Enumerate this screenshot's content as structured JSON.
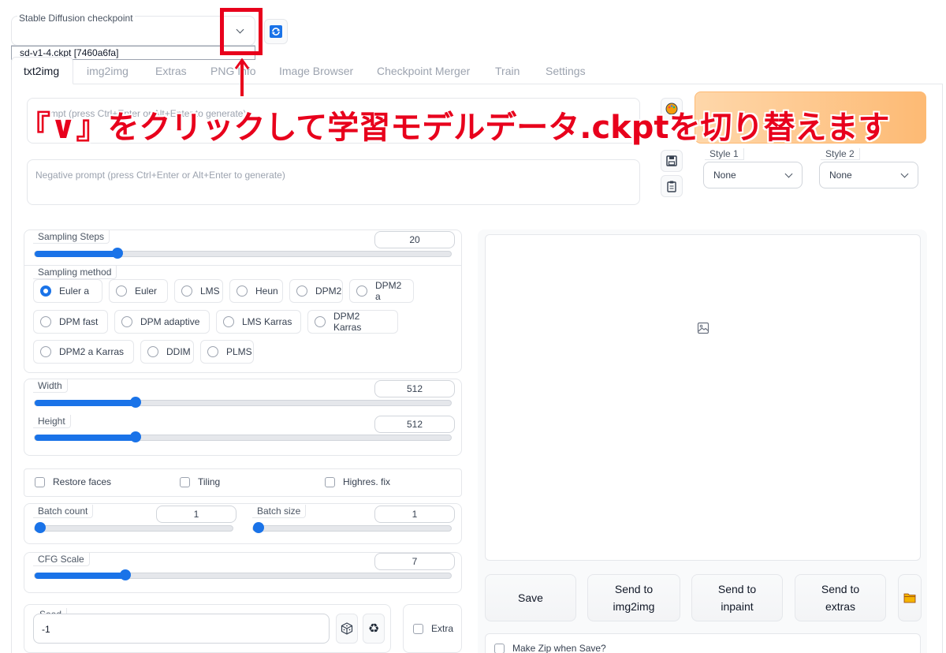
{
  "checkpoint": {
    "label": "Stable Diffusion checkpoint",
    "dropdown_option": "sd-v1-4.ckpt [7460a6fa]",
    "refresh_icon": "refresh-icon"
  },
  "tabs": [
    "txt2img",
    "img2img",
    "Extras",
    "PNG Info",
    "Image Browser",
    "Checkpoint Merger",
    "Train",
    "Settings"
  ],
  "prompt": {
    "placeholder": "Prompt (press Ctrl+Enter or Alt+Enter to generate)",
    "negative_placeholder": "Negative prompt (press Ctrl+Enter or Alt+Enter to generate)"
  },
  "annotation": {
    "text": "『∨』をクリックして学習モデルデータ.ckptを切り替えます",
    "color": "#e8001c"
  },
  "styles": {
    "style1_label": "Style 1",
    "style1_value": "None",
    "style2_label": "Style 2",
    "style2_value": "None"
  },
  "sampling_steps": {
    "label": "Sampling Steps",
    "value": "20",
    "fraction": 0.19
  },
  "sampling_method": {
    "label": "Sampling method",
    "selected": "Euler a",
    "rows": [
      [
        "Euler a",
        "Euler",
        "LMS",
        "Heun",
        "DPM2",
        "DPM2 a"
      ],
      [
        "DPM fast",
        "DPM adaptive",
        "LMS Karras",
        "DPM2 Karras"
      ],
      [
        "DPM2 a Karras",
        "DDIM",
        "PLMS"
      ]
    ]
  },
  "width": {
    "label": "Width",
    "value": "512",
    "fraction": 0.235
  },
  "height": {
    "label": "Height",
    "value": "512",
    "fraction": 0.235
  },
  "checks": {
    "restore_faces": "Restore faces",
    "tiling": "Tiling",
    "highres": "Highres. fix"
  },
  "batch_count": {
    "label": "Batch count",
    "value": "1",
    "fraction": 0.0
  },
  "batch_size": {
    "label": "Batch size",
    "value": "1",
    "fraction": 0.0
  },
  "cfg_scale": {
    "label": "CFG Scale",
    "value": "7",
    "fraction": 0.21
  },
  "seed": {
    "label": "Seed",
    "value": "-1",
    "extra_label": "Extra"
  },
  "buttons": {
    "save": "Save",
    "send_img2img_1": "Send to",
    "send_img2img_2": "img2img",
    "send_inpaint_1": "Send to",
    "send_inpaint_2": "inpaint",
    "send_extras_1": "Send to",
    "send_extras_2": "extras"
  },
  "make_zip": "Make Zip when Save?",
  "accent_color": "#1a73e8",
  "generate_color": "#fdba74"
}
